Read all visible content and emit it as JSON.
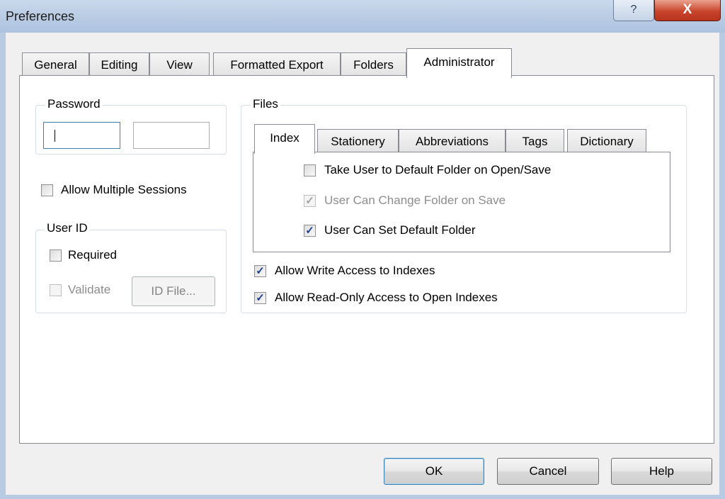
{
  "window": {
    "title": "Preferences",
    "help_label": "?",
    "close_label": "X"
  },
  "tabs": [
    {
      "label": "General"
    },
    {
      "label": "Editing"
    },
    {
      "label": "View"
    },
    {
      "label": "Formatted Export"
    },
    {
      "label": "Folders"
    },
    {
      "label": "Administrator"
    }
  ],
  "password": {
    "legend": "Password",
    "field1_value": "",
    "field2_value": ""
  },
  "allow_multiple_sessions": {
    "label": "Allow Multiple Sessions",
    "checked": false
  },
  "user_id": {
    "legend": "User ID",
    "required": {
      "label": "Required",
      "checked": false
    },
    "validate": {
      "label": "Validate",
      "checked": false,
      "enabled": false
    },
    "id_file_button": "ID File..."
  },
  "files": {
    "legend": "Files",
    "tabs": [
      {
        "label": "Index"
      },
      {
        "label": "Stationery"
      },
      {
        "label": "Abbreviations"
      },
      {
        "label": "Tags"
      },
      {
        "label": "Dictionary"
      }
    ],
    "options": [
      {
        "label": "Take User to Default Folder on Open/Save",
        "checked": false,
        "enabled": true
      },
      {
        "label": "User Can Change Folder on Save",
        "checked": true,
        "enabled": false
      },
      {
        "label": "User Can Set Default Folder",
        "checked": true,
        "enabled": true
      }
    ],
    "allow_write": {
      "label": "Allow Write Access to Indexes",
      "checked": true
    },
    "allow_readonly": {
      "label": "Allow Read-Only Access to Open Indexes",
      "checked": true
    }
  },
  "buttons": {
    "ok": "OK",
    "cancel": "Cancel",
    "help": "Help"
  },
  "colors": {
    "accent": "#3c7fb1",
    "check": "#1e3f8f",
    "close": "#c8452c"
  }
}
